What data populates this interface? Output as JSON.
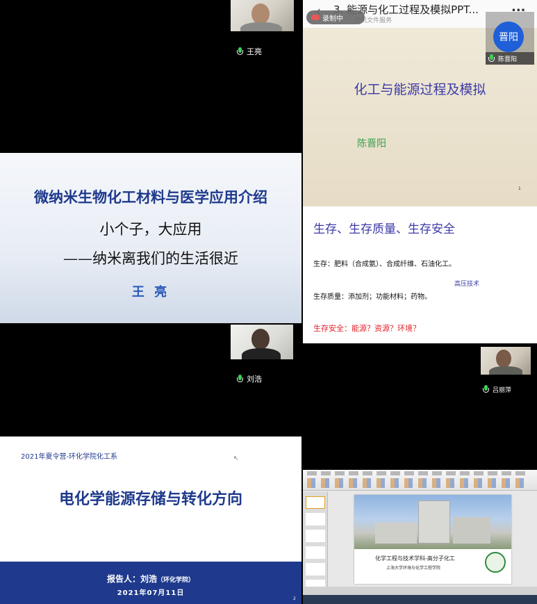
{
  "participants": {
    "p1": {
      "name": "王亮"
    },
    "p2": {
      "name": "陈晋阳",
      "avatar_text": "晋阳"
    },
    "p3": {
      "name": "刘浩"
    },
    "p4": {
      "name": "吕丽萍"
    }
  },
  "slide_wang": {
    "title": "微纳米生物化工材料与医学应用介绍",
    "line1": "小个子，大应用",
    "line2": "——纳米离我们的生活很近",
    "author": "王 亮"
  },
  "doc_header": {
    "title": "3. 能源与化工过程及模拟PPT...",
    "subtitle": "腾讯文件服务",
    "recording_label": "录制中",
    "menu": "..."
  },
  "slide_chen_1": {
    "title": "化工与能源过程及模拟",
    "author": "陈晋阳",
    "page": "1"
  },
  "slide_chen_2": {
    "heading": "生存、生存质量、生存安全",
    "line1": "生存：肥料（合成氨）、合成纤维、石油化工。",
    "tag": "高压技术",
    "line2": "生存质量：添加剂；功能材料；药物。",
    "line3": "生存安全：能源？资源？环境？"
  },
  "slide_liu": {
    "camp": "2021年夏令营-环化学院化工系",
    "title": "电化学能源存储与转化方向",
    "reporter_label": "报告人：刘浩",
    "reporter_org": "（环化学院）",
    "date": "2021年07月11日",
    "page": "2"
  },
  "ppt_window": {
    "slide_caption": "化学工程与技术学科-高分子化工",
    "slide_sub": "上海大学环境与化学工程学院"
  },
  "colors": {
    "accent_blue": "#1f3a8c",
    "title_red": "#e0222a",
    "green": "#3a9f4d",
    "avatar_blue": "#1f5fd7"
  }
}
